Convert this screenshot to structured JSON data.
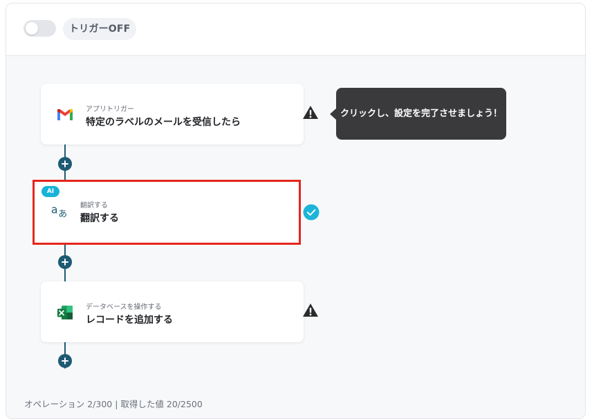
{
  "header": {
    "trigger_toggle_state": "off",
    "trigger_label": "トリガーOFF"
  },
  "flow": {
    "steps": [
      {
        "subtitle": "アプリトリガー",
        "title": "特定のラベルのメールを受信したら",
        "icon": "gmail-icon",
        "status": "warning"
      },
      {
        "badge": "AI",
        "subtitle": "翻訳する",
        "title": "翻訳する",
        "icon": "translate-icon",
        "status": "complete",
        "selected": true
      },
      {
        "subtitle": "データベースを操作する",
        "title": "レコードを追加する",
        "icon": "excel-icon",
        "status": "warning"
      }
    ],
    "tooltip": "クリックし、設定を完了させましょう！"
  },
  "footer": {
    "usage": "オペレーション 2/300 | 取得した値 20/2500"
  },
  "colors": {
    "connector": "#1e5a73",
    "selected_border": "#e4261b",
    "ai_badge": "#19b3d8",
    "check": "#1cb5d9",
    "tooltip_bg": "#3a3a3d"
  }
}
